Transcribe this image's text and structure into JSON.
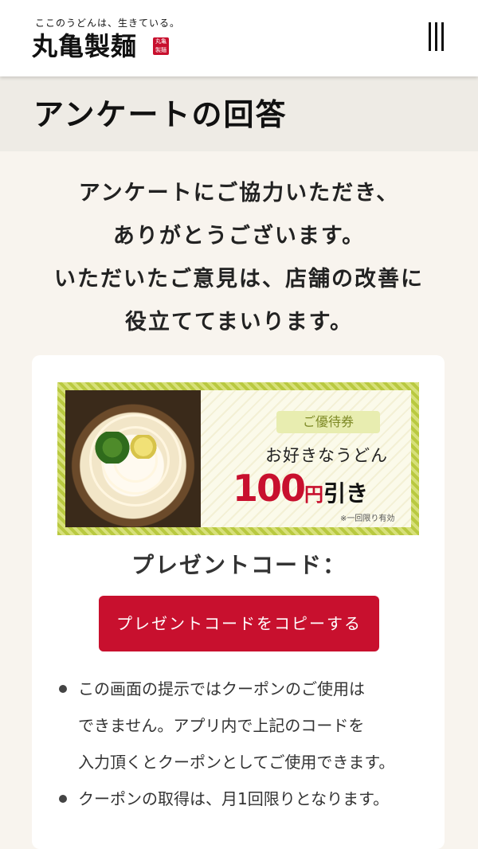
{
  "header": {
    "tagline": "ここのうどんは、生きている。",
    "logo": "丸亀製麺",
    "seal": "丸亀製麺"
  },
  "page": {
    "title": "アンケートの回答"
  },
  "thanks": {
    "lines": [
      "アンケートにご協力いただき、",
      "ありがとうございます。",
      "いただいたご意見は、店舗の改善に",
      "役立ててまいります。"
    ]
  },
  "coupon": {
    "label": "ご優待券",
    "description": "お好きなうどん",
    "amount": "100",
    "currency": "円",
    "suffix": "引き",
    "note": "※一回限り有効"
  },
  "present_code": {
    "label": "プレゼントコード：",
    "copy_button": "プレゼントコードをコピーする"
  },
  "notes": [
    {
      "lines": [
        "この画面の提示ではクーポンのご使用は",
        "できません。アプリ内で上記のコードを",
        "入力頂くとクーポンとしてご使用できます。"
      ]
    },
    {
      "lines": [
        "クーポンの取得は、月1回限りとなります。"
      ]
    }
  ],
  "colors": {
    "accent_red": "#c8102e",
    "background": "#f8f4ee",
    "title_band": "#eeebe5",
    "coupon_border": "#b9c940"
  }
}
